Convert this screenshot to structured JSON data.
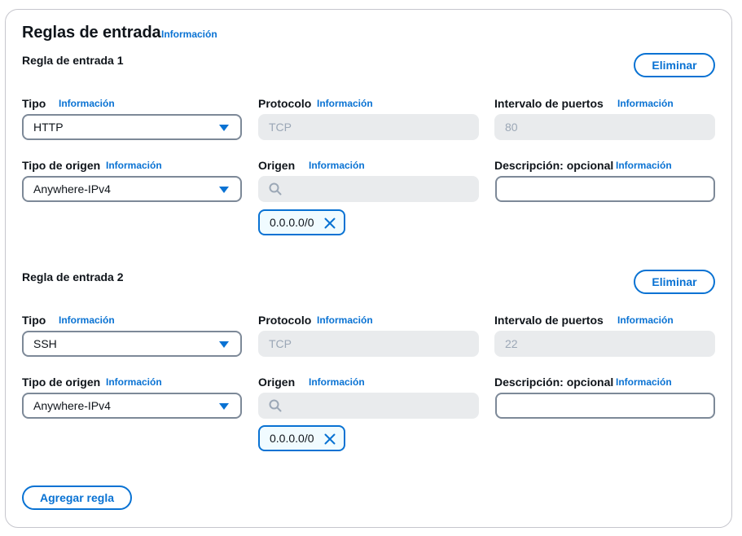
{
  "section": {
    "title": "Reglas de entrada",
    "info": "Información"
  },
  "rules": [
    {
      "heading": "Regla de entrada 1",
      "delete_label": "Eliminar",
      "type_label": "Tipo",
      "type_info": "Información",
      "type_value": "HTTP",
      "protocol_label": "Protocolo",
      "protocol_info": "Información",
      "protocol_value": "TCP",
      "port_label": "Intervalo de puertos",
      "port_info": "Información",
      "port_value": "80",
      "source_type_label": "Tipo de origen",
      "source_type_info": "Información",
      "source_type_value": "Anywhere-IPv4",
      "source_label": "Origen",
      "source_info": "Información",
      "source_token": "0.0.0.0/0",
      "desc_label": "Descripción: opcional",
      "desc_info": "Información",
      "desc_value": ""
    },
    {
      "heading": "Regla de entrada 2",
      "delete_label": "Eliminar",
      "type_label": "Tipo",
      "type_info": "Información",
      "type_value": "SSH",
      "protocol_label": "Protocolo",
      "protocol_info": "Información",
      "protocol_value": "TCP",
      "port_label": "Intervalo de puertos",
      "port_info": "Información",
      "port_value": "22",
      "source_type_label": "Tipo de origen",
      "source_type_info": "Información",
      "source_type_value": "Anywhere-IPv4",
      "source_label": "Origen",
      "source_info": "Información",
      "source_token": "0.0.0.0/0",
      "desc_label": "Descripción: opcional",
      "desc_info": "Información",
      "desc_value": ""
    }
  ],
  "add_rule_label": "Agregar regla",
  "colors": {
    "accent": "#0972d3",
    "border": "#7d8998",
    "disabled_bg": "#e9ebed",
    "disabled_text": "#9ba7b6"
  },
  "icons": {
    "select_caret": "caret-down-icon",
    "search": "search-icon",
    "remove_token": "close-icon"
  }
}
